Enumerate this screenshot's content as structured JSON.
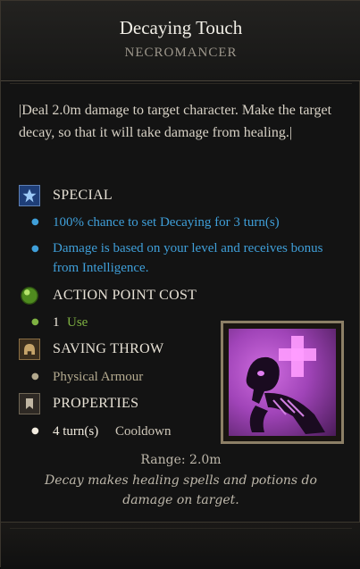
{
  "tooltip": {
    "title": "Decaying Touch",
    "subtitle": "NECROMANCER",
    "description": "|Deal 2.0m damage to target character. Make the target decay, so that it will take damage from healing.|",
    "sections": {
      "special": {
        "label": "SPECIAL",
        "icon": "star-icon",
        "lines": [
          "100% chance to set Decaying for 3 turn(s)",
          "Damage is based on your level and receives bonus from Intelligence."
        ],
        "color": "#3f9fd9"
      },
      "ap_cost": {
        "label": "ACTION POINT COST",
        "icon": "green-orb-icon",
        "value": "1",
        "unit": "Use",
        "color": "#7fb242"
      },
      "saving_throw": {
        "label": "SAVING THROW",
        "icon": "helmet-icon",
        "value": "Physical Armour"
      },
      "properties": {
        "label": "PROPERTIES",
        "icon": "bookmark-icon",
        "value": "4 turn(s)",
        "suffix": "Cooldown"
      }
    },
    "range": "Range: 2.0m",
    "flavor": "Decay makes healing spells and potions do damage on target.",
    "skill_icon": "skeleton-with-cross-icon"
  }
}
